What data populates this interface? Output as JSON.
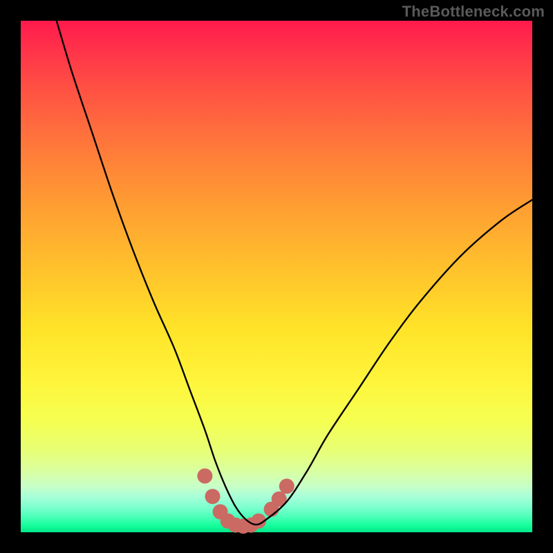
{
  "watermark": "TheBottleneck.com",
  "chart_data": {
    "type": "line",
    "title": "",
    "xlabel": "",
    "ylabel": "",
    "xlim": [
      0,
      100
    ],
    "ylim": [
      0,
      100
    ],
    "grid": false,
    "legend": false,
    "description": "V-shaped bottleneck curve over a vertical rainbow gradient (red at top through yellow to green at bottom). The curve descends steeply from top-left, reaches a minimum near the bottom-center-left, then rises toward the upper-right. A cluster of salmon-colored dots sits at and around the curve minimum.",
    "series": [
      {
        "name": "bottleneck-curve",
        "color": "#000000",
        "x": [
          7,
          10,
          14,
          18,
          22,
          26,
          30,
          33,
          36,
          38,
          40,
          42,
          44,
          46,
          48,
          52,
          56,
          60,
          66,
          72,
          78,
          86,
          94,
          100
        ],
        "y": [
          100,
          90,
          78,
          66,
          55,
          45,
          36,
          28,
          20,
          14,
          9,
          5,
          2.5,
          1.5,
          2.5,
          6,
          12,
          19,
          28,
          37,
          45,
          54,
          61,
          65
        ]
      }
    ],
    "markers": {
      "color": "#cb6a63",
      "radius_outer": 11,
      "radius_inner": 9,
      "points": [
        {
          "x": 36.0,
          "y": 11.0
        },
        {
          "x": 37.5,
          "y": 7.0
        },
        {
          "x": 39.0,
          "y": 4.0
        },
        {
          "x": 40.5,
          "y": 2.2
        },
        {
          "x": 42.0,
          "y": 1.4
        },
        {
          "x": 43.5,
          "y": 1.2
        },
        {
          "x": 45.0,
          "y": 1.4
        },
        {
          "x": 46.5,
          "y": 2.2
        },
        {
          "x": 49.0,
          "y": 4.5
        },
        {
          "x": 50.5,
          "y": 6.5
        },
        {
          "x": 52.0,
          "y": 9.0
        }
      ]
    }
  }
}
